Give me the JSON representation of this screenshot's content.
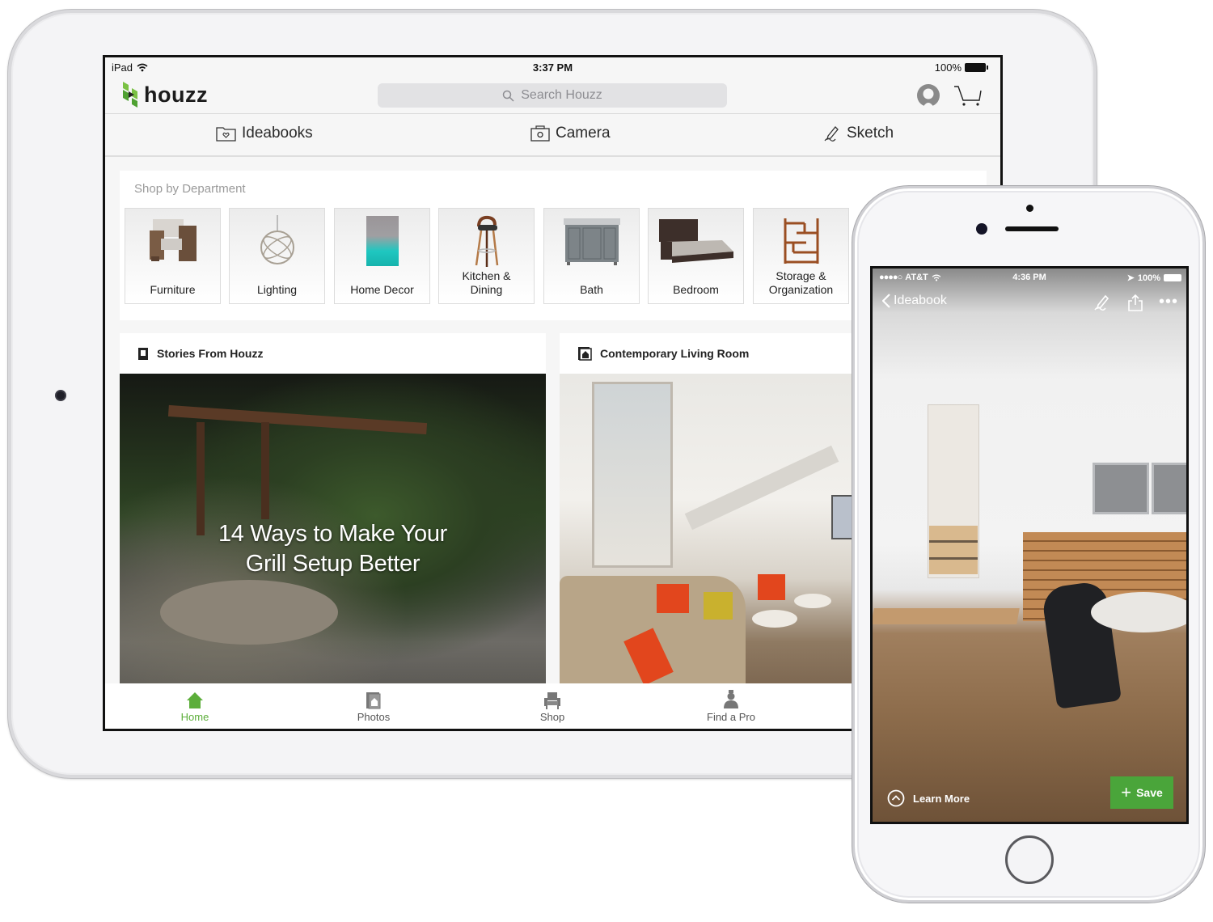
{
  "ipad": {
    "status": {
      "device": "iPad",
      "time": "3:37 PM",
      "battery": "100%"
    },
    "header": {
      "brand": "houzz",
      "search_placeholder": "Search Houzz"
    },
    "toolbar": [
      {
        "label": "Ideabooks",
        "icon": "ideabook-folder-icon"
      },
      {
        "label": "Camera",
        "icon": "camera-icon"
      },
      {
        "label": "Sketch",
        "icon": "sketch-pen-icon"
      }
    ],
    "shop": {
      "title": "Shop by Department",
      "departments": [
        {
          "label": "Furniture",
          "icon": "armchair-image"
        },
        {
          "label": "Lighting",
          "icon": "pendant-light-image"
        },
        {
          "label": "Home Decor",
          "icon": "art-print-image"
        },
        {
          "label": "Kitchen & Dining",
          "icon": "bar-stool-image"
        },
        {
          "label": "Bath",
          "icon": "vanity-image"
        },
        {
          "label": "Bedroom",
          "icon": "bed-image"
        },
        {
          "label": "Storage & Organization",
          "icon": "bookshelf-image"
        }
      ]
    },
    "cards": [
      {
        "title": "Stories From Houzz",
        "icon": "story-book-icon",
        "overlay_title": "14 Ways to Make Your Grill Setup Better"
      },
      {
        "title": "Contemporary Living Room",
        "icon": "photo-house-icon"
      }
    ],
    "tabs": [
      {
        "label": "Home",
        "active": true
      },
      {
        "label": "Photos",
        "active": false
      },
      {
        "label": "Shop",
        "active": false
      },
      {
        "label": "Find a Pro",
        "active": false
      }
    ],
    "colors": {
      "accent": "#5cae3a"
    }
  },
  "iphone": {
    "status": {
      "carrier": "AT&T",
      "time": "4:36 PM",
      "battery": "100%"
    },
    "nav": {
      "back_label": "Ideabook"
    },
    "learn_more": "Learn More",
    "save_label": "Save",
    "colors": {
      "save": "#4aa53a"
    }
  }
}
